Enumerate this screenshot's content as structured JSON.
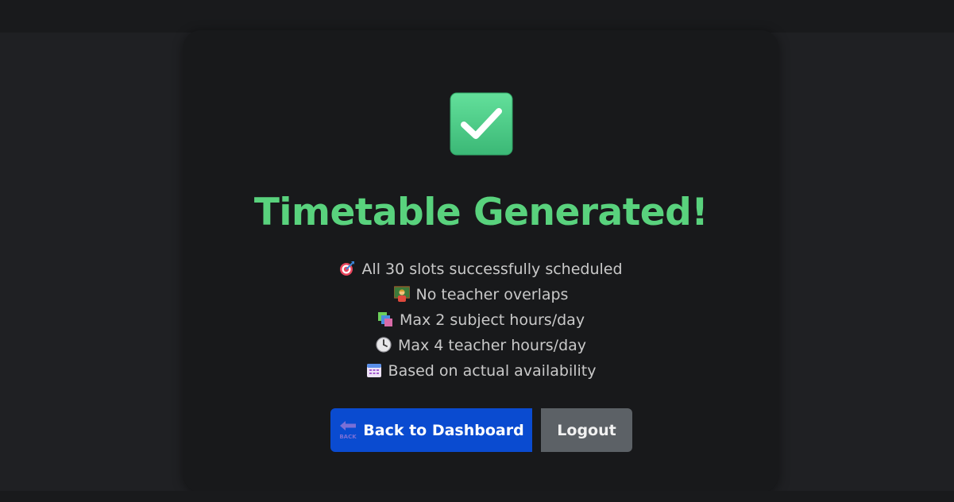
{
  "card": {
    "title": "Timetable Generated!",
    "features": [
      {
        "icon": "target-icon",
        "text": "All 30 slots successfully scheduled"
      },
      {
        "icon": "teacher-icon",
        "text": "No teacher overlaps"
      },
      {
        "icon": "books-icon",
        "text": "Max 2 subject hours/day"
      },
      {
        "icon": "clock-icon",
        "text": "Max 4 teacher hours/day"
      },
      {
        "icon": "calendar-icon",
        "text": "Based on actual availability"
      }
    ]
  },
  "actions": {
    "back_label": "Back to Dashboard",
    "back_icon_text": "BACK",
    "logout_label": "Logout"
  },
  "colors": {
    "success": "#59d27d",
    "primary_button": "#0a4bd0",
    "secondary_button": "#5c6166"
  }
}
